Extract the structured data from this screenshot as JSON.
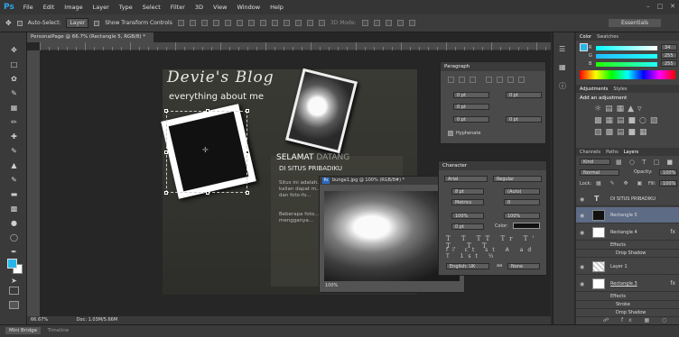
{
  "app": {
    "logo": "Ps"
  },
  "menu": [
    "File",
    "Edit",
    "Image",
    "Layer",
    "Type",
    "Select",
    "Filter",
    "3D",
    "View",
    "Window",
    "Help"
  ],
  "options": {
    "auto_select_label": "Auto-Select:",
    "auto_select_value": "Layer",
    "transform_label": "Show Transform Controls",
    "mode_3d": "3D Mode:",
    "workspace": "Essentials"
  },
  "document": {
    "tab_title": "PersonalPage @ 66.7% (Rectangle 5, RGB/8) *",
    "zoom": "66.67%",
    "doc_size": "Doc: 1.03M/5.66M"
  },
  "canvas": {
    "title": "Devie's Blog",
    "subtitle": "everything about me",
    "selamat": "SELAMAT",
    "datang": "DATANG",
    "disitus": "DI SITUS PRIBADIKU",
    "body1": "Situs ini adalah... kalian dapat m... ku dan foto-fo...",
    "body2": "Beberapa foto... mengganya..."
  },
  "float_window": {
    "title": "bunga1.jpg @ 100% (RGB/8#) *",
    "zoom": "100%"
  },
  "paragraph_panel": {
    "title": "Paragraph",
    "fields": [
      "0 pt",
      "0 pt",
      "0 pt",
      "0 pt",
      "0 pt"
    ],
    "hyphenate": "Hyphenate"
  },
  "character_panel": {
    "title": "Character",
    "font": "Arial",
    "style": "Regular",
    "size": "8 pt",
    "leading": "(Auto)",
    "kerning": "Metrics",
    "tracking": "0",
    "vscale": "100%",
    "hscale": "100%",
    "baseline": "0 pt",
    "color_label": "Color:",
    "language": "English: UK",
    "aa": "aa",
    "aa_mode": "None"
  },
  "color_panel": {
    "tabs": [
      "Color",
      "Swatches"
    ],
    "r": "34",
    "g": "255",
    "b": "255"
  },
  "adjustments_panel": {
    "tabs": [
      "Adjustments",
      "Styles"
    ],
    "heading": "Add an adjustment"
  },
  "layers_panel": {
    "tabs": [
      "Channels",
      "Paths",
      "Layers"
    ],
    "kind": "Kind",
    "blend_mode": "Normal",
    "opacity_label": "Opacity:",
    "opacity": "100%",
    "lock_label": "Lock:",
    "fill_label": "Fill:",
    "fill": "100%",
    "layers": [
      {
        "name": "DI SITUS PRIBADIKU",
        "type": "text"
      },
      {
        "name": "Rectangle 5",
        "type": "shape"
      },
      {
        "name": "Rectangle 4",
        "type": "shape"
      },
      {
        "name": "Effects",
        "type": "fx"
      },
      {
        "name": "Drop Shadow",
        "type": "fx-item"
      },
      {
        "name": "Layer 1",
        "type": "pixel"
      },
      {
        "name": "Rectangle 3",
        "type": "shape"
      },
      {
        "name": "Effects",
        "type": "fx"
      },
      {
        "name": "Stroke",
        "type": "fx-item"
      },
      {
        "name": "Drop Shadow",
        "type": "fx-item"
      }
    ]
  },
  "bottom": {
    "tabs": [
      "Mini Bridge",
      "Timeline"
    ]
  },
  "colors": {
    "accent": "#2fa3e6",
    "foreground": "#27b6e8",
    "background": "#ffffff",
    "selected_layer": "#5d6b85"
  }
}
